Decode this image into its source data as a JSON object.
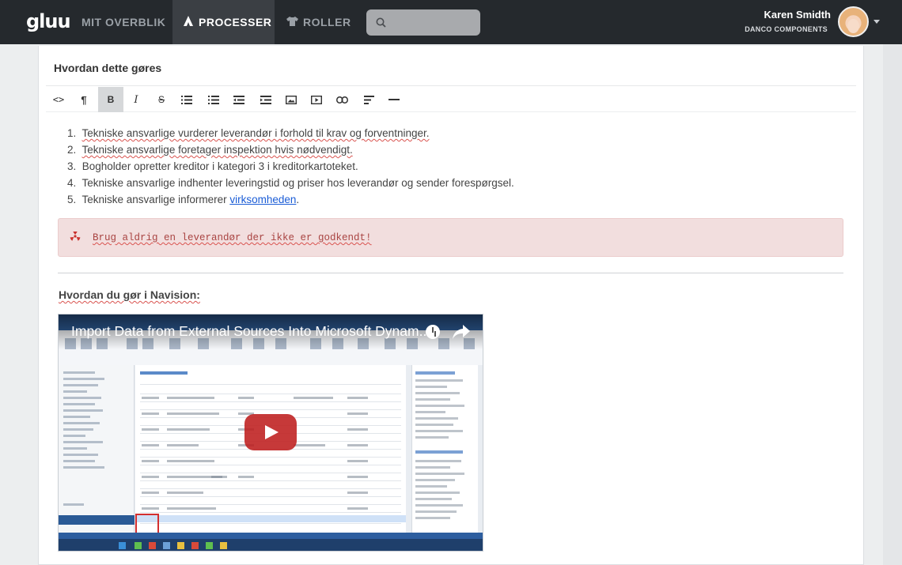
{
  "navbar": {
    "logo": "gluu",
    "items": [
      {
        "label": "MIT OVERBLIK",
        "icon": "",
        "active": false
      },
      {
        "label": "PROCESSER",
        "icon": "sitemap-icon",
        "active": true
      },
      {
        "label": "ROLLER",
        "icon": "tshirt-icon",
        "active": false
      }
    ],
    "search": {
      "placeholder": "",
      "icon": "search-icon"
    },
    "user": {
      "name": "Karen Smidth",
      "company": "DANCO COMPONENTS",
      "avatar": "avatar",
      "menu_icon": "caret-down-icon"
    }
  },
  "section": {
    "title": "Hvordan dette gøres"
  },
  "toolbar": {
    "buttons": [
      {
        "name": "html-icon",
        "glyph": "<>",
        "active": false
      },
      {
        "name": "paragraph-icon",
        "glyph": "¶",
        "active": false
      },
      {
        "name": "bold-icon",
        "glyph": "B",
        "active": true
      },
      {
        "name": "italic-icon",
        "glyph": "I",
        "active": false
      },
      {
        "name": "strikethrough-icon",
        "glyph": "S",
        "active": false
      },
      {
        "name": "unordered-list-icon",
        "glyph": "",
        "active": false
      },
      {
        "name": "ordered-list-icon",
        "glyph": "",
        "active": false
      },
      {
        "name": "outdent-icon",
        "glyph": "",
        "active": false
      },
      {
        "name": "indent-icon",
        "glyph": "",
        "active": false
      },
      {
        "name": "image-icon",
        "glyph": "",
        "active": false
      },
      {
        "name": "video-icon",
        "glyph": "",
        "active": false
      },
      {
        "name": "link-icon",
        "glyph": "",
        "active": false
      },
      {
        "name": "align-icon",
        "glyph": "",
        "active": false
      },
      {
        "name": "horizontal-rule-icon",
        "glyph": "",
        "active": false
      }
    ]
  },
  "content": {
    "steps": [
      {
        "num": "1.",
        "text": "Tekniske ansvarlige vurderer leverandør i forhold til krav og forventninger."
      },
      {
        "num": "2.",
        "text": "Tekniske ansvarlige foretager inspektion hvis nødvendigt."
      },
      {
        "num": "3.",
        "text": "Bogholder opretter kreditor i kategori 3 i kreditorkartoteket."
      },
      {
        "num": "4.",
        "text": "Tekniske ansvarlige indhenter leveringstid og priser hos leverandør og sender forespørgsel."
      },
      {
        "num": "5.",
        "text_before": "Tekniske ansvarlige informerer ",
        "link": "virksomheden",
        "text_after": "."
      }
    ],
    "warning": {
      "icon": "radiation-icon",
      "text": "Brug aldrig en leverandør der ikke er godkendt!"
    },
    "navision_heading": "Hvordan du gør i Navision:",
    "video": {
      "title": "Import Data from External Sources Into Microsoft Dynam...",
      "clock_icon": "watch-later-icon",
      "share_icon": "share-icon",
      "play_icon": "play-button-icon"
    }
  },
  "colors": {
    "navbar": "#25292d",
    "active_nav": "#3b3f44",
    "alert_bg": "#f2dede",
    "alert_text": "#a94442",
    "link": "#1a5cd6",
    "youtube_red": "#cc181e"
  }
}
